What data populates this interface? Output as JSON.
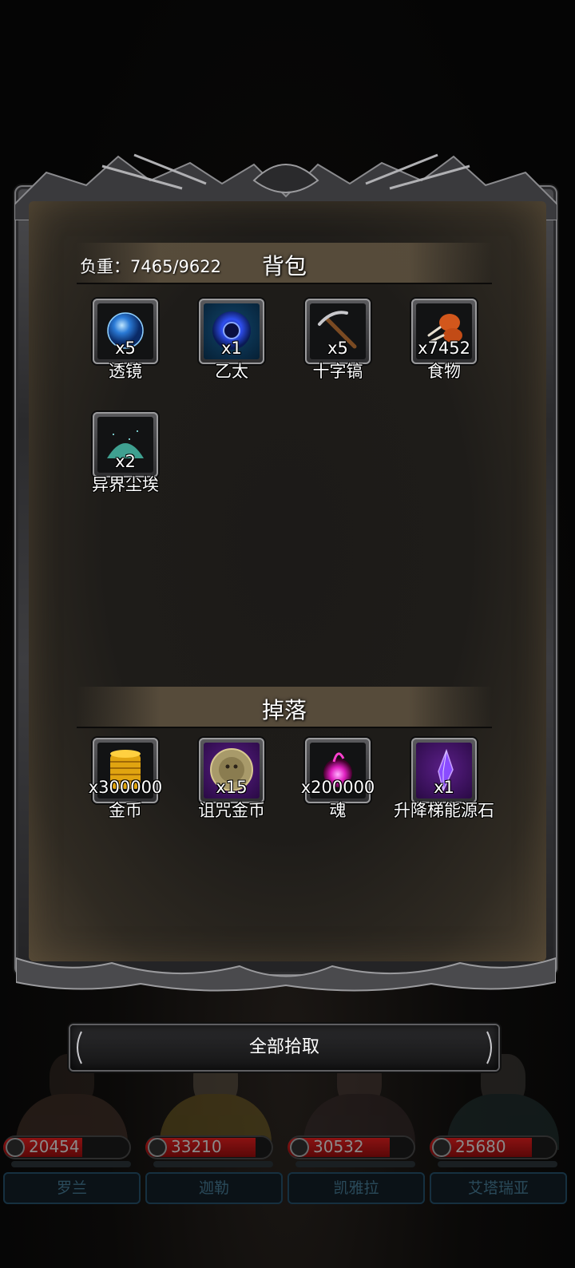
{
  "backpack": {
    "weight_label": "负重：7465/9622",
    "title": "背包",
    "items": [
      {
        "count": "x5",
        "name": "透镜",
        "icon": "lens-orb-icon"
      },
      {
        "count": "x1",
        "name": "乙太",
        "icon": "ether-orb-icon"
      },
      {
        "count": "x5",
        "name": "十字镐",
        "icon": "pickaxe-icon"
      },
      {
        "count": "x7452",
        "name": "食物",
        "icon": "meat-icon"
      },
      {
        "count": "x2",
        "name": "异界尘埃",
        "icon": "dust-pile-icon"
      }
    ]
  },
  "drops": {
    "title": "掉落",
    "items": [
      {
        "count": "x300000",
        "name": "金币",
        "icon": "gold-coins-icon"
      },
      {
        "count": "x15",
        "name": "诅咒金币",
        "icon": "cursed-coin-icon"
      },
      {
        "count": "x200000",
        "name": "魂",
        "icon": "soul-flame-icon"
      },
      {
        "count": "x1",
        "name": "升降梯能源石",
        "icon": "crystal-icon"
      }
    ]
  },
  "actions": {
    "pickup_all": "全部拾取"
  },
  "party": [
    {
      "hp": "20454",
      "name": "罗兰",
      "hp_fraction": 0.62
    },
    {
      "hp": "33210",
      "name": "迦勒",
      "hp_fraction": 0.86
    },
    {
      "hp": "30532",
      "name": "凯雅拉",
      "hp_fraction": 0.8
    },
    {
      "hp": "25680",
      "name": "艾塔瑞亚",
      "hp_fraction": 0.8
    }
  ],
  "colors": {
    "hp_red": "#8a1212",
    "epic_purple": "#5a1f87",
    "rare_blue": "#11456b"
  }
}
